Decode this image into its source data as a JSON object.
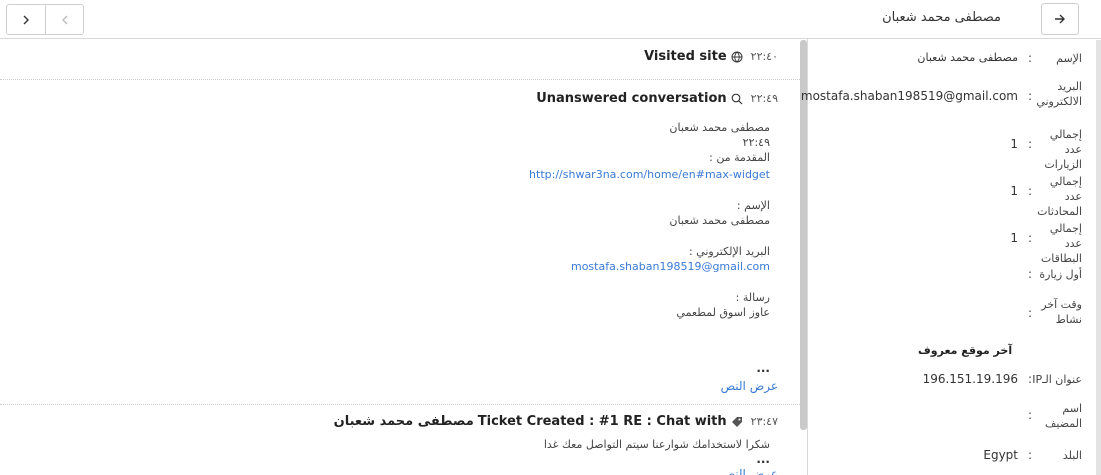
{
  "header": {
    "title": "مصطفى محمد شعبان",
    "next_icon": "chevron-right-icon",
    "prev_icon": "chevron-left-icon",
    "back_icon": "arrow-right-icon"
  },
  "events": [
    {
      "time": "٢٢:٤٠",
      "title": "Visited site",
      "icon": "globe-icon"
    },
    {
      "time": "٢٢:٤٩",
      "title": "Unanswered conversation",
      "icon": "search-icon",
      "name": "مصطفى محمد شعبان",
      "msg_time": "٢٢:٤٩",
      "from_label": "المقدمة من :",
      "from_url": "http://shwar3na.com/home/en#max-widget",
      "name_label": "الإسم :",
      "name_value": "مصطفى محمد شعبان",
      "email_label": "البريد الإلكتروني :",
      "email_value": "mostafa.shaban198519@gmail.com",
      "message_label": "رسالة :",
      "message_value": "عاوز اسوق لمطعمي",
      "ellipsis": "...",
      "show_text": "عرض النص"
    },
    {
      "time": "٢٣:٤٧",
      "title": "Ticket Created : #1 RE : Chat with",
      "title_name": "مصطفى محمد شعبان",
      "icon": "tag-icon",
      "body": "شكرا لاستخدامك شوارعنا سيتم التواصل معك غدا",
      "ellipsis": "...",
      "show_text": "عرض النص"
    }
  ],
  "contact": {
    "name_label": "الإسم",
    "name_value": "مصطفى محمد شعبان",
    "email_label": "البريد الالكتروني",
    "email_value": "mostafa.shaban198519@gmail.com",
    "visits_label": "إجمالي عدد الزيارات",
    "visits_value": "1",
    "chats_label": "إجمالي عدد المحادثات",
    "chats_value": "1",
    "tickets_label": "إجمالي عدد البطاقات",
    "tickets_value": "1",
    "first_visit_label": "أول زيارة",
    "last_activity_label": "وقت آخر نشاط",
    "last_location_heading": "آخر موقع معروف",
    "ip_label": "عنوان الـIP",
    "ip_value": "196.151.19.196",
    "host_label": "اسم المضيف",
    "country_label": "البلد",
    "country_value": "Egypt"
  }
}
